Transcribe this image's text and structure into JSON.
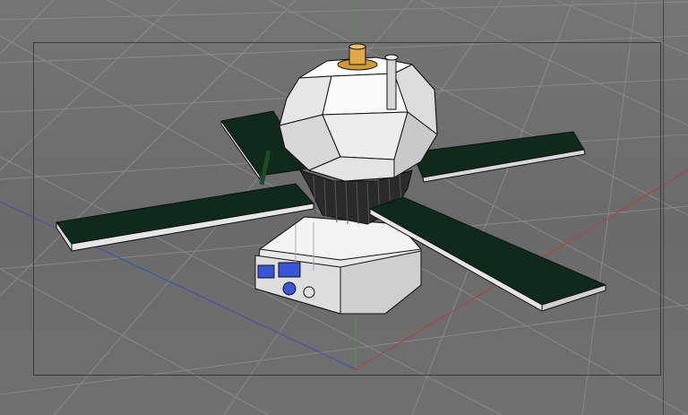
{
  "viewport": {
    "background": "#6e6e6e",
    "grid_color": "#8a8a8a",
    "axis_x_color": "#b04040",
    "axis_z_color": "#4050b0",
    "axis_y_color": "#3aa03a",
    "icon": "3d-viewport"
  },
  "model": {
    "icon": "satellite-model",
    "parts": [
      "body-icon",
      "solar-panel-icon",
      "base-icon",
      "antenna-icon"
    ],
    "colors": {
      "body": "#f2f2f2",
      "panel": "#0f2a1a",
      "band": "#2a2a2a",
      "cap": "#d09a3a",
      "base": "#e8e8e8",
      "screen": "#3a55d8"
    }
  }
}
